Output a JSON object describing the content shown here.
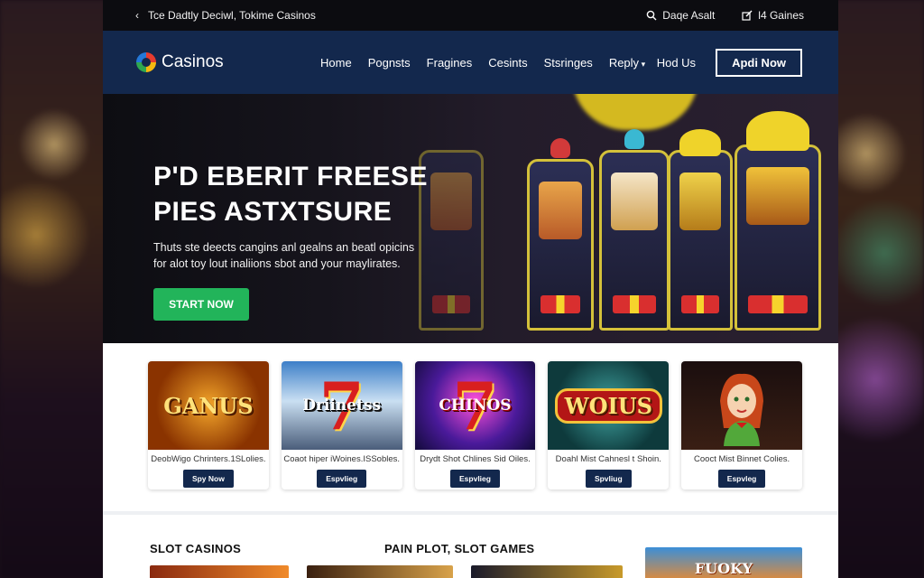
{
  "topbar": {
    "tagline": "Tce Dadtly Deciwl, Tokime Casinos",
    "search_label": "Daqe Asalt",
    "account_label": "l4 Gaines"
  },
  "nav": {
    "brand": "Casinos",
    "menu": [
      "Home",
      "Pognsts",
      "Fragines",
      "Cesints",
      "Stsringes",
      "Reply"
    ],
    "help": "Hod Us",
    "apply": "Apdi Now"
  },
  "hero": {
    "title_line1": "P'D EBERIT FREESE",
    "title_line2": "PIES ASTXTSURE",
    "subtitle": "Thuts ste deects cangins anl gealns an beatl opicins for alot toy lout inaliions sbot and your maylirates.",
    "cta": "START NOW"
  },
  "cards": [
    {
      "art": "GANUS",
      "desc": "DeobWigo Chrinters.1SLolies.",
      "button": "Spy Now"
    },
    {
      "art": "Driinetss",
      "desc": "Coaot hiper iWoines.ISSobles.",
      "button": "Espvlieg"
    },
    {
      "art": "CHINOS",
      "desc": "Drydt Shot Chlines Sid Oiles.",
      "button": "Espvlieg"
    },
    {
      "art": "WOIUS",
      "desc": "Doahl Mist Cahnesl t Shoin.",
      "button": "Spvliug"
    },
    {
      "art": "",
      "desc": "Cooct Mist Binnet Colies.",
      "button": "Espvleg"
    }
  ],
  "sections": {
    "left": "SLOT CASINOS",
    "middle": "PAIN PLOT, SLOT GAMES",
    "side_card": "FUOKY"
  },
  "colors": {
    "nav_bg": "#13284d",
    "cta_green": "#22b45a",
    "topbar_bg": "#0c0c10"
  }
}
